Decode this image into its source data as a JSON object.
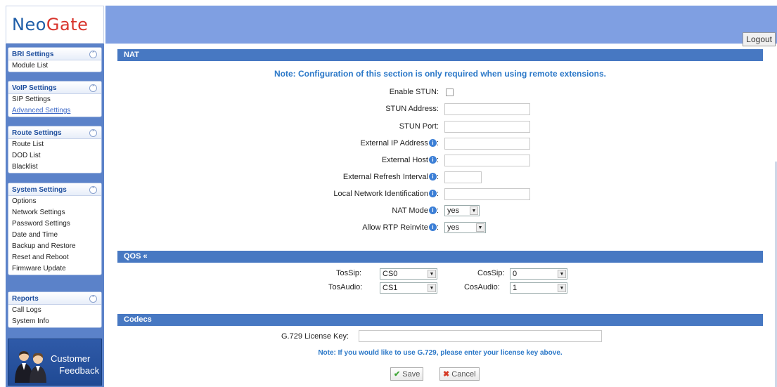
{
  "header": {
    "logo_prefix": "Neo",
    "logo_suffix": "Gate",
    "logout_label": "Logout"
  },
  "colors": {
    "header_band": "#7f9fe2",
    "section_bar": "#4778c2",
    "note_text": "#2b78c8",
    "sidebar_bg": "#5b82c9"
  },
  "sidebar": {
    "groups": [
      {
        "title": "BRI Settings",
        "items": [
          "Module List"
        ]
      },
      {
        "title": "VoIP Settings",
        "items": [
          "SIP Settings",
          "Advanced Settings"
        ]
      },
      {
        "title": "Route Settings",
        "items": [
          "Route List",
          "DOD List",
          "Blacklist"
        ]
      },
      {
        "title": "System Settings",
        "items": [
          "Options",
          "Network Settings",
          "Password Settings",
          "Date and Time",
          "Backup and Restore",
          "Reset and Reboot",
          "Firmware Update"
        ]
      },
      {
        "title": "Reports",
        "items": [
          "Call Logs",
          "System Info"
        ]
      }
    ],
    "collapse_icon": "collapse-up-icon",
    "feedback": {
      "line1": "Customer",
      "line2": "Feedback"
    }
  },
  "nat": {
    "title": "NAT",
    "note": "Note: Configuration of this section is only required when using remote extensions.",
    "enable_stun_label": "Enable STUN:",
    "enable_stun_checked": false,
    "stun_address_label": "STUN Address:",
    "stun_address_value": "",
    "stun_port_label": "STUN Port:",
    "stun_port_value": "",
    "external_ip_label": "External IP Address",
    "external_ip_value": "",
    "external_host_label": "External Host",
    "external_host_value": "",
    "refresh_interval_label": "External Refresh Interval",
    "refresh_interval_value": "",
    "local_network_label": "Local Network Identification",
    "local_network_value": "",
    "nat_mode_label": "NAT Mode",
    "nat_mode_value": "yes",
    "allow_rtp_label": "Allow RTP Reinvite",
    "allow_rtp_value": "yes",
    "colon": ":",
    "info_glyph": "i"
  },
  "qos": {
    "title": "QOS",
    "title_icon": "«",
    "tos_sip_label": "TosSip:",
    "tos_sip_value": "CS0",
    "cos_sip_label": "CosSip:",
    "cos_sip_value": "0",
    "tos_audio_label": "TosAudio:",
    "tos_audio_value": "CS1",
    "cos_audio_label": "CosAudio:",
    "cos_audio_value": "1"
  },
  "codecs": {
    "title": "Codecs",
    "license_label": "G.729 License Key:",
    "license_value": "",
    "note": "Note: If you would like to use G.729, please enter your license key above."
  },
  "actions": {
    "save_label": "Save",
    "cancel_label": "Cancel"
  }
}
